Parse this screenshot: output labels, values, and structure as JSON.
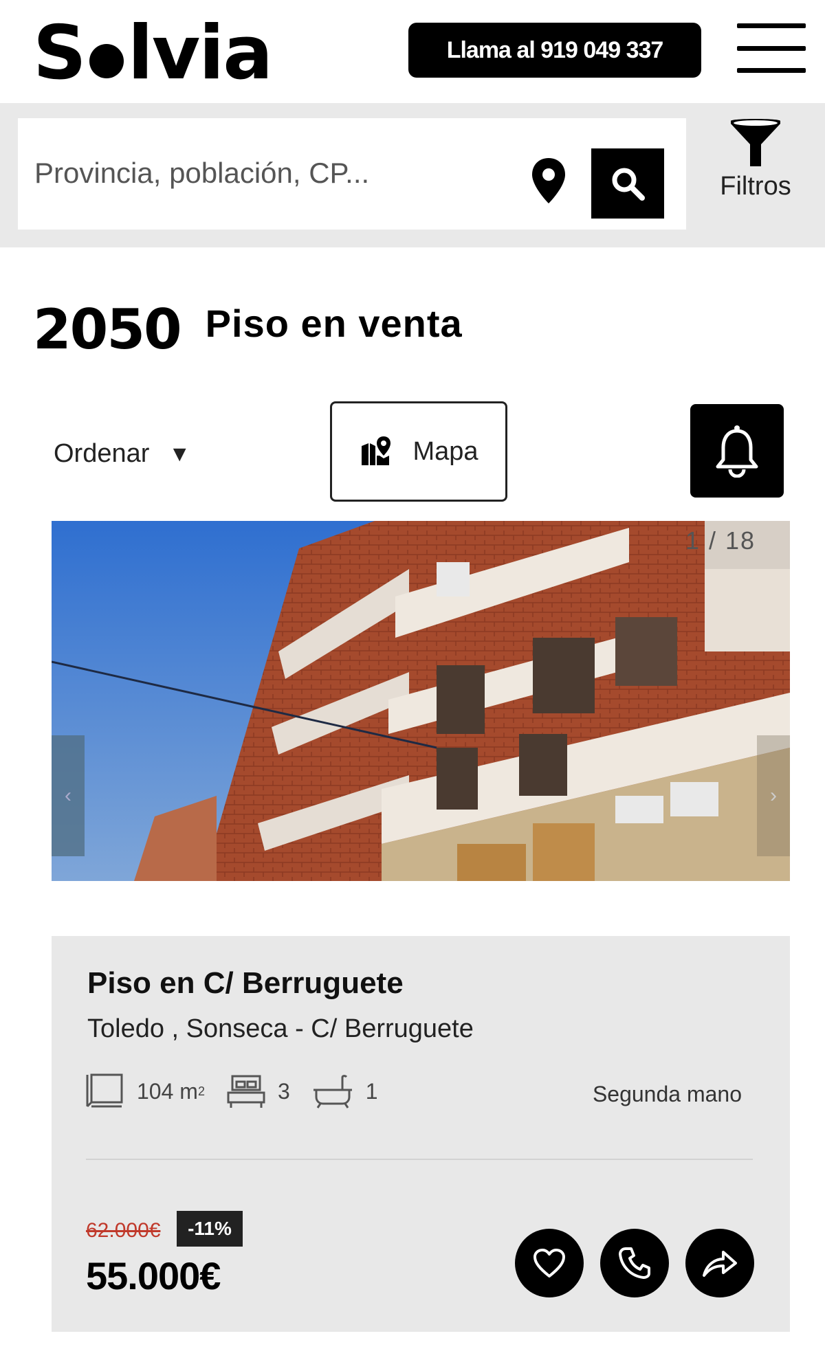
{
  "header": {
    "logo_text": "Solvia",
    "call_label": "Llama al 919 049 337",
    "menu_icon": "hamburger-menu-icon"
  },
  "search": {
    "placeholder": "Provincia, población, CP...",
    "value": "",
    "filters_label": "Filtros",
    "location_icon": "map-pin-icon",
    "search_icon": "search-icon",
    "filters_icon": "funnel-icon"
  },
  "results": {
    "count": "2050",
    "type": "Piso en venta"
  },
  "toolbar": {
    "sort_label": "Ordenar",
    "sort_arrow": "▼",
    "map_label": "Mapa",
    "alert_icon": "bell-icon"
  },
  "listing": {
    "photo_counter": "1 / 18",
    "title": "Piso en C/ Berruguete",
    "location": "Toledo , Sonseca - C/ Berruguete",
    "area_value": "104 m",
    "area_sup": "2",
    "bedrooms": "3",
    "bathrooms": "1",
    "condition": "Segunda mano",
    "old_price": "62.000€",
    "discount": "-11%",
    "price": "55.000€",
    "prev_glyph": "‹",
    "next_glyph": "›",
    "actions": [
      "heart-icon",
      "phone-icon",
      "share-icon"
    ]
  },
  "colors": {
    "band": "#e9e9e9",
    "card": "#e8e8e8",
    "old_price": "#c0392b",
    "sky": "#3f78c8",
    "brick": "#a4452a"
  }
}
